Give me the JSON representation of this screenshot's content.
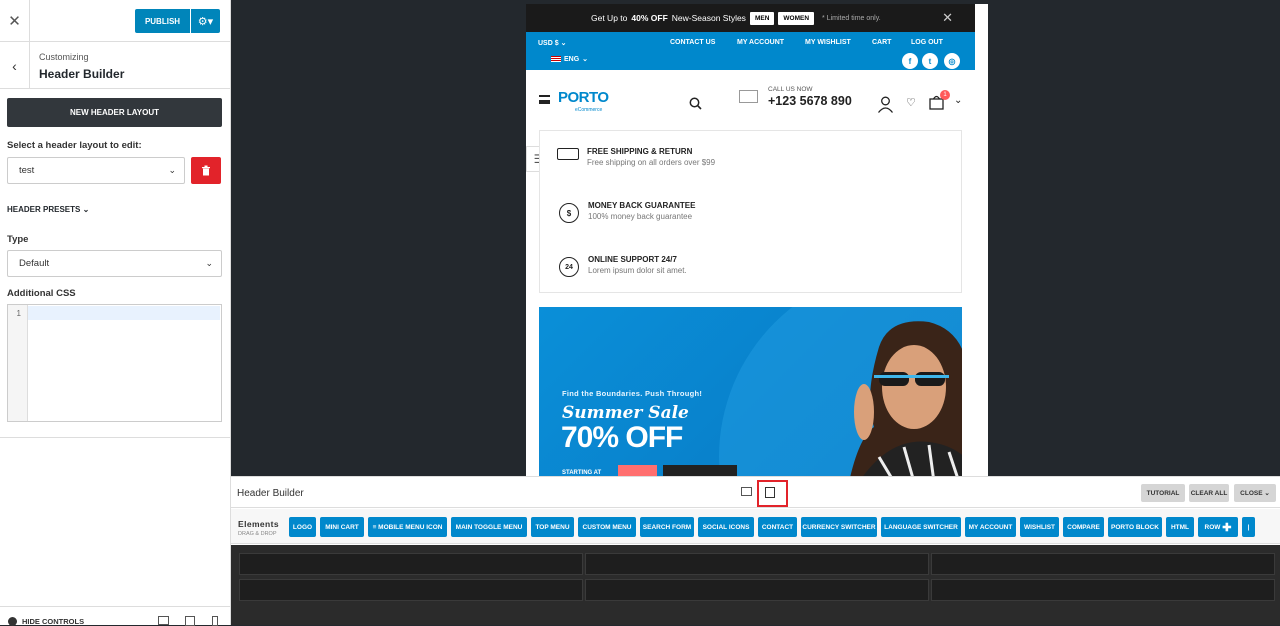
{
  "sidebar": {
    "close_icon": "close-icon",
    "publish_label": "PUBLISH",
    "breadcrumb_small": "Customizing",
    "breadcrumb_title": "Header Builder",
    "new_layout_label": "NEW HEADER LAYOUT",
    "select_label": "Select a header layout to edit:",
    "layout_value": "test",
    "presets_label": "HEADER PRESETS",
    "type_label": "Type",
    "type_value": "Default",
    "css_label": "Additional CSS",
    "css_line_number": "1",
    "hide_controls": "HIDE CONTROLS"
  },
  "preview": {
    "promo": {
      "text_before": "Get Up to",
      "bold": "40% OFF",
      "text_after": "New-Season Styles",
      "tag_men": "MEN",
      "tag_women": "WOMEN",
      "note": "* Limited time only."
    },
    "topnav": {
      "currency": "USD $",
      "language": "ENG",
      "links": [
        "CONTACT US",
        "MY ACCOUNT",
        "MY WISHLIST",
        "CART",
        "LOG OUT"
      ]
    },
    "header": {
      "logo": "PORTO",
      "logo_sub": "eCommerce",
      "call_label": "CALL US NOW",
      "phone": "+123 5678 890",
      "cart_count": "1"
    },
    "info": [
      {
        "title": "FREE SHIPPING & RETURN",
        "sub": "Free shipping on all orders over $99"
      },
      {
        "title": "MONEY BACK GUARANTEE",
        "sub": "100% money back guarantee"
      },
      {
        "title": "ONLINE SUPPORT 24/7",
        "sub": "Lorem ipsum dolor sit amet."
      }
    ],
    "banner": {
      "tagline": "Find the Boundaries. Push Through!",
      "script": "Summer Sale",
      "headline": "70% OFF",
      "starting": "STARTING AT"
    }
  },
  "builder": {
    "title": "Header Builder",
    "tutorial": "TUTORIAL",
    "clear_all": "CLEAR ALL",
    "close": "CLOSE",
    "elements_title": "Elements",
    "elements_sub": "DRAG & DROP",
    "elements": [
      "LOGO",
      "MINI CART",
      "≡ MOBILE MENU ICON",
      "MAIN TOGGLE MENU",
      "TOP MENU",
      "CUSTOM MENU",
      "SEARCH FORM",
      "SOCIAL ICONS",
      "CONTACT",
      "CURRENCY SWITCHER",
      "LANGUAGE SWITCHER",
      "MY ACCOUNT",
      "WISHLIST",
      "COMPARE",
      "PORTO BLOCK",
      "HTML"
    ],
    "row_label": "ROW",
    "divider_label": "|"
  },
  "colors": {
    "accent": "#0088cc",
    "publish": "#0085ba",
    "danger": "#e2232a"
  }
}
